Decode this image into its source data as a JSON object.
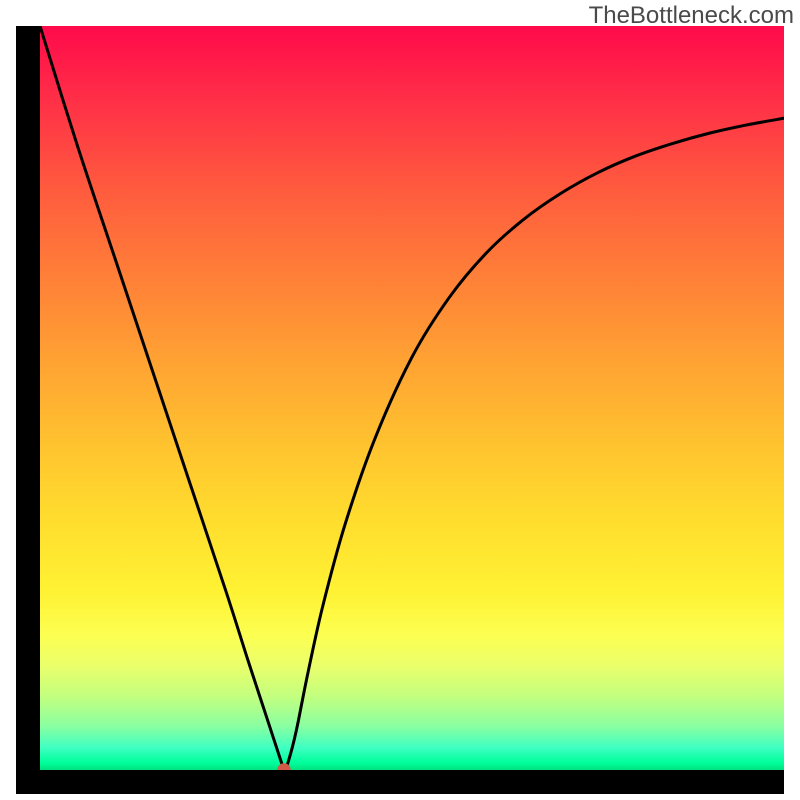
{
  "watermark": "TheBottleneck.com",
  "chart_data": {
    "type": "line",
    "title": "",
    "xlabel": "",
    "ylabel": "",
    "xlim": [
      0,
      100
    ],
    "ylim": [
      0,
      100
    ],
    "gradient_colors_top_to_bottom": [
      "#ff0a4a",
      "#ff2f47",
      "#ff5b3e",
      "#ff7d38",
      "#ffa233",
      "#ffc22f",
      "#ffdc2e",
      "#fff233",
      "#fcff52",
      "#eaff6b",
      "#c4ff7e",
      "#8cffa0",
      "#3fffc2",
      "#00ff9c",
      "#00e27f"
    ],
    "marker": {
      "x": 32.8,
      "y": 0,
      "radius_frac": 0.009,
      "color": "#d55a45"
    },
    "series": [
      {
        "name": "curve",
        "x": [
          0,
          5,
          10,
          15,
          20,
          25,
          28,
          30,
          31.7,
          32.8,
          33.0,
          33.9,
          34.6,
          36,
          38,
          41,
          45,
          50,
          55,
          60,
          65,
          70,
          75,
          80,
          85,
          90,
          95,
          100
        ],
        "y": [
          100,
          84,
          69,
          54,
          39,
          24,
          14.6,
          8.5,
          3.3,
          0.0,
          0.0,
          3.0,
          6.0,
          13,
          22,
          33,
          44.5,
          55.5,
          63.5,
          69.5,
          74.0,
          77.5,
          80.3,
          82.5,
          84.2,
          85.6,
          86.7,
          87.6
        ]
      }
    ]
  }
}
